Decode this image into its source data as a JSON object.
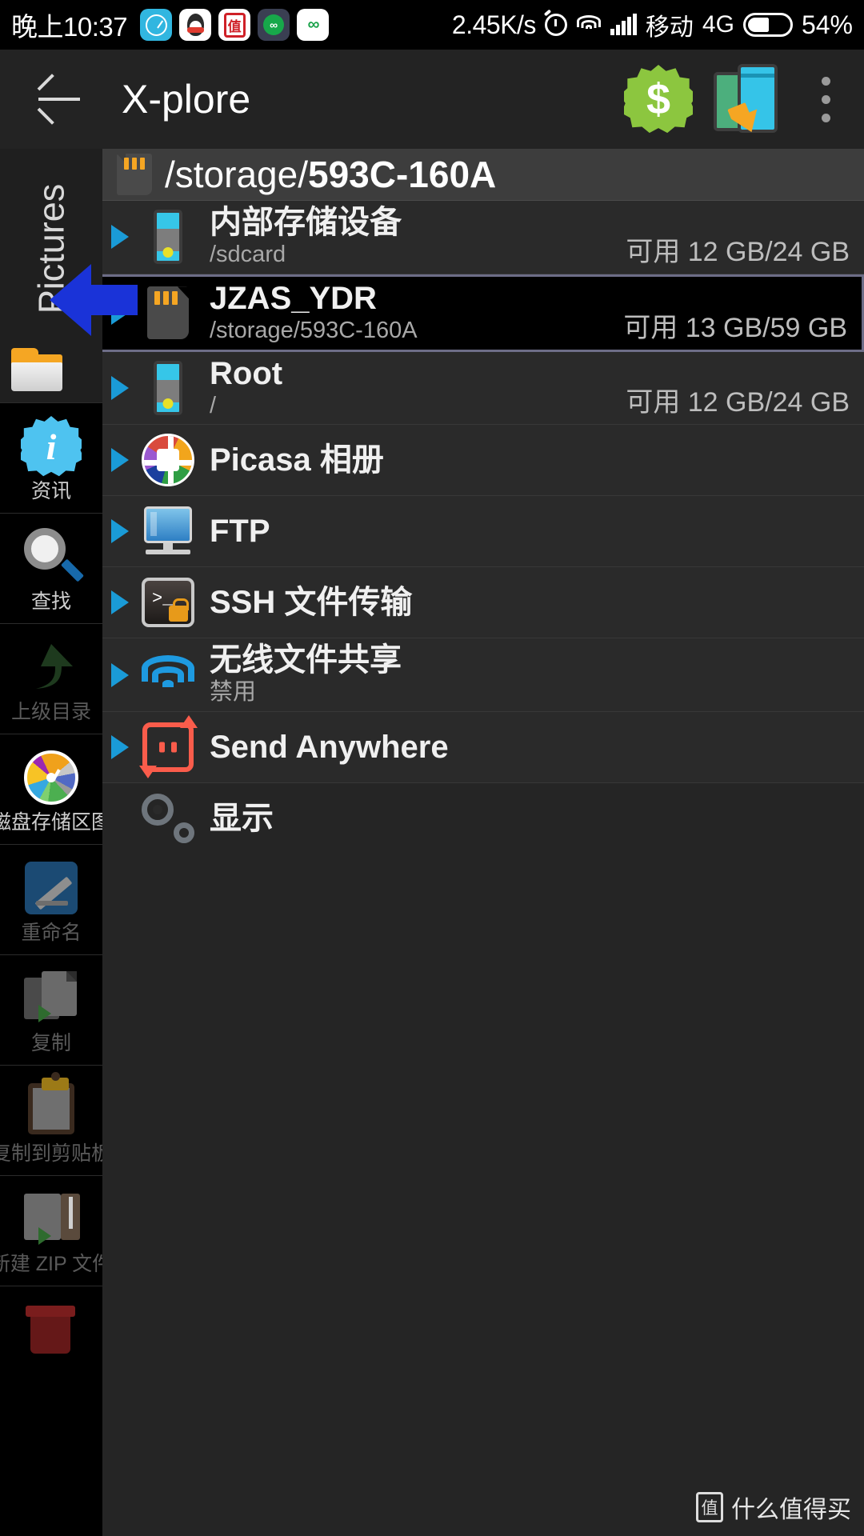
{
  "status_bar": {
    "clock": "晚上10:37",
    "app_icons": [
      "compass-icon",
      "qq-icon",
      "zdm-icon",
      "alpha-icon",
      "infinity-icon"
    ],
    "network_speed": "2.45K/s",
    "alarm_icon": "alarm-icon",
    "wifi_icon": "wifi-icon",
    "signal_icon": "signal-bars-icon",
    "carrier": "移动",
    "network_type": "4G",
    "battery_icon": "battery-icon",
    "battery_percent": "54%"
  },
  "app_bar": {
    "back_icon": "back-arrow-icon",
    "title": "X-plore",
    "donate_icon": "dollar-badge-icon",
    "donate_label": "$",
    "transfer_icon": "phone-transfer-icon",
    "overflow_icon": "overflow-menu-icon"
  },
  "sidebar": {
    "header": {
      "vertical_label": "Pictures",
      "folder_icon": "folder-icon"
    },
    "items": [
      {
        "label": "资讯",
        "icon": "info-badge-icon",
        "dim": false
      },
      {
        "label": "查找",
        "icon": "search-icon",
        "dim": false
      },
      {
        "label": "上级目录",
        "icon": "up-arrow-icon",
        "dim": true
      },
      {
        "label": "磁盘存储区图",
        "icon": "disk-usage-pie-icon",
        "dim": false
      },
      {
        "label": "重命名",
        "icon": "rename-pencil-icon",
        "dim": true
      },
      {
        "label": "复制",
        "icon": "copy-icon",
        "dim": true
      },
      {
        "label": "复制到剪贴板",
        "icon": "clipboard-icon",
        "dim": true
      },
      {
        "label": "新建 ZIP 文件",
        "icon": "zip-icon",
        "dim": true
      },
      {
        "label": "",
        "icon": "delete-bin-icon",
        "dim": true
      }
    ]
  },
  "main": {
    "path_bar": {
      "icon": "sdcard-icon",
      "prefix": "/storage/",
      "name": "593C-160A"
    },
    "rows": [
      {
        "expand_icon": "expand-triangle-icon",
        "icon": "internal-storage-icon",
        "name": "内部存储设备",
        "sub": "/sdcard",
        "free": "可用 12 GB/24 GB",
        "selected": false
      },
      {
        "expand_icon": "expand-triangle-icon",
        "icon": "sdcard-icon",
        "name": "JZAS_YDR",
        "sub": "/storage/593C-160A",
        "free": "可用 13 GB/59 GB",
        "selected": true
      },
      {
        "expand_icon": "expand-triangle-icon",
        "icon": "root-storage-icon",
        "name": "Root",
        "sub": "/",
        "free": "可用 12 GB/24 GB",
        "selected": false
      },
      {
        "expand_icon": "expand-triangle-icon",
        "icon": "picasa-icon",
        "name": "Picasa 相册",
        "sub": "",
        "free": "",
        "selected": false
      },
      {
        "expand_icon": "expand-triangle-icon",
        "icon": "ftp-icon",
        "name": "FTP",
        "sub": "",
        "free": "",
        "selected": false
      },
      {
        "expand_icon": "expand-triangle-icon",
        "icon": "ssh-icon",
        "name": "SSH 文件传输",
        "sub": "",
        "free": "",
        "selected": false
      },
      {
        "expand_icon": "expand-triangle-icon",
        "icon": "wifi-share-icon",
        "name": "无线文件共享",
        "sub": "禁用",
        "free": "",
        "selected": false
      },
      {
        "expand_icon": "expand-triangle-icon",
        "icon": "send-anywhere-icon",
        "name": "Send Anywhere",
        "sub": "",
        "free": "",
        "selected": false
      },
      {
        "expand_icon": "",
        "icon": "gears-icon",
        "name": "显示",
        "sub": "",
        "free": "",
        "selected": false
      }
    ]
  },
  "overlay": {
    "pointer_icon": "blue-left-arrow-pointer"
  },
  "watermark": {
    "seal_glyph": "值",
    "text": "什么值得买"
  },
  "colors": {
    "accent_blue": "#1a9bd7",
    "pointer_blue": "#1a33d8",
    "selected_border": "#6d6d87",
    "panel_bg": "#252525",
    "row_bg": "#2a2a2a",
    "path_bar_bg": "#3d3d3d",
    "donate_green": "#8cc63f"
  }
}
